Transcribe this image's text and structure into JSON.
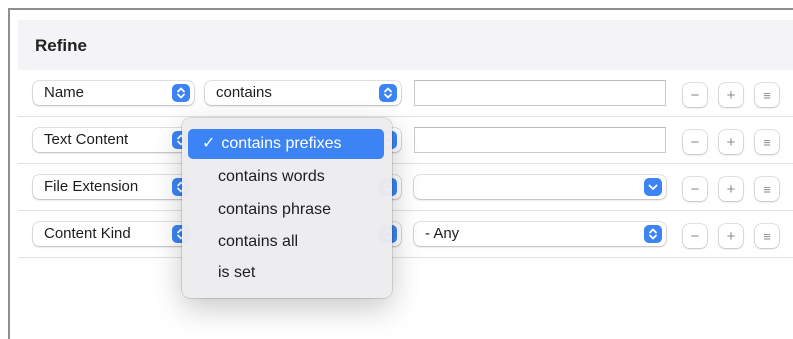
{
  "panel": {
    "title": "Refine"
  },
  "rows": [
    {
      "attribute": "Name",
      "operator": "contains",
      "value": ""
    },
    {
      "attribute": "Text Content",
      "operator": "contains prefixes",
      "value": ""
    },
    {
      "attribute": "File Extension",
      "operator": "",
      "value": ""
    },
    {
      "attribute": "Content Kind",
      "operator": "",
      "value": "- Any"
    }
  ],
  "buttons": {
    "remove": "−",
    "add": "+",
    "options": "≡"
  },
  "menu": {
    "check": "✓",
    "items": [
      "contains prefixes",
      "contains words",
      "contains phrase",
      "contains all",
      "is set"
    ],
    "selected_index": 0
  },
  "colors": {
    "accent": "#3c84f5"
  }
}
